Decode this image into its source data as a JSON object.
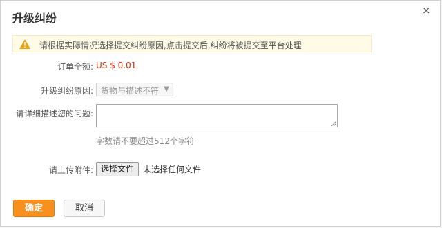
{
  "dialog": {
    "title": "升级纠纷",
    "close_glyph": "×"
  },
  "notice": {
    "icon": "warning-icon",
    "text": "请根据实际情况选择提交纠纷原因,点击提交后,纠纷将被提交至平台处理"
  },
  "form": {
    "amount_label": "订单全额:",
    "amount_value": "US $ 0.01",
    "reason_label": "升级纠纷原因:",
    "reason_value": "货物与描述不符",
    "describe_label": "请详细描述您的问题:",
    "describe_value": "",
    "char_limit_hint": "字数请不要超过512个字符",
    "attach_label": "请上传附件:",
    "file_button_label": "选择文件",
    "file_status": "未选择任何文件"
  },
  "actions": {
    "confirm_label": "确定",
    "cancel_label": "取消"
  },
  "colors": {
    "accent": "#f98f1d",
    "amount": "#d62a00",
    "notice_bg": "#fffbe6",
    "warning": "#e8a317"
  }
}
